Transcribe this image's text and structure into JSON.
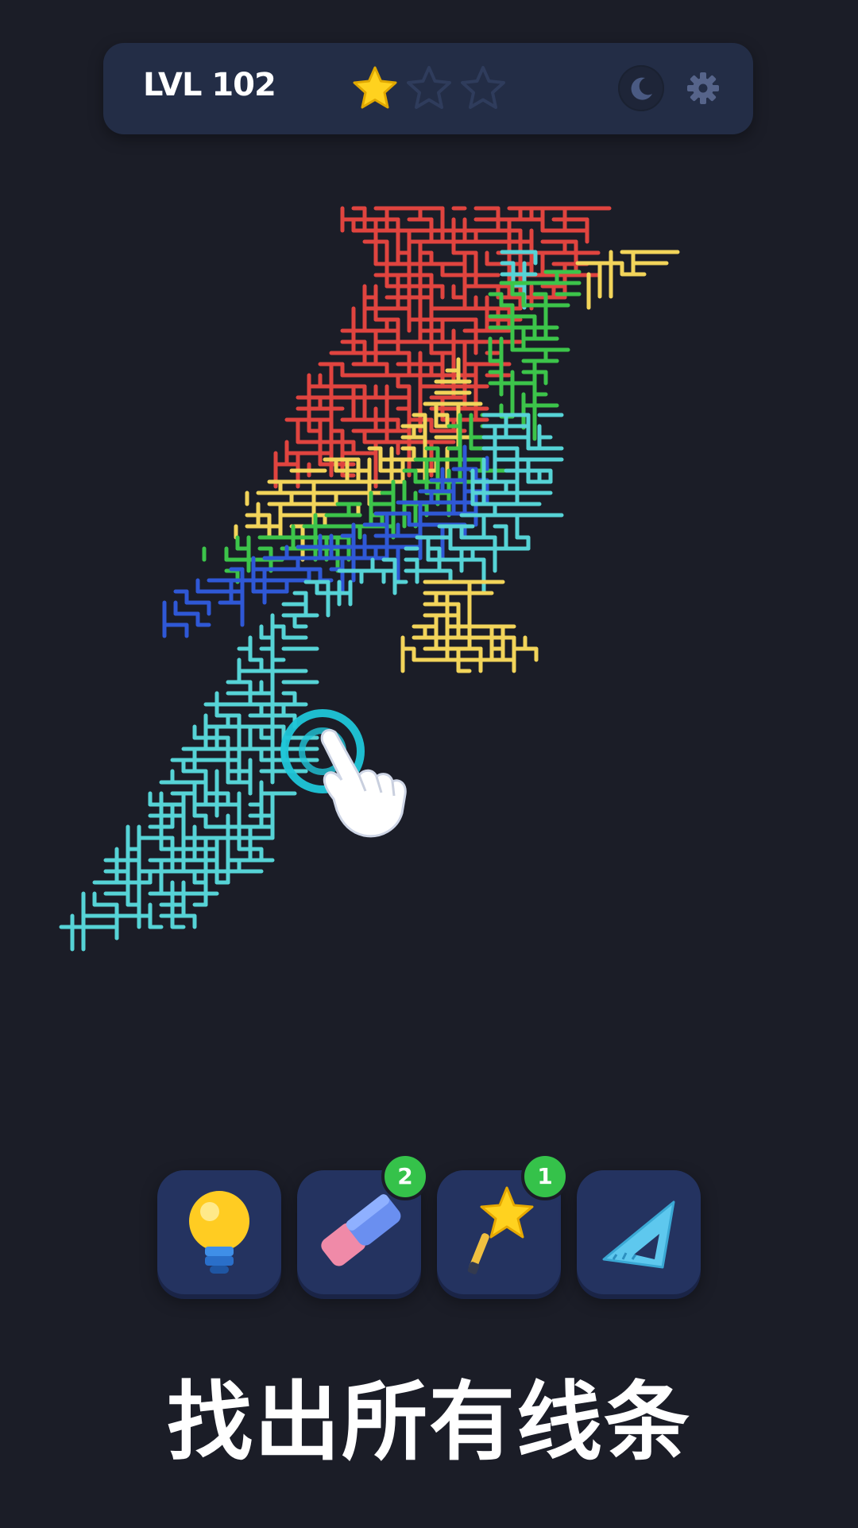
{
  "header": {
    "level_label": "LVL 102",
    "stars_earned": 1,
    "stars_total": 3,
    "moon_icon": "moon-icon",
    "settings_icon": "gear-icon"
  },
  "colors": {
    "background": "#1b1d27",
    "red": "#e0443f",
    "yellow": "#f2d45a",
    "green": "#3cc44a",
    "blue": "#2f58d6",
    "cyan": "#56d3d6",
    "star_gold": "#ffd21f",
    "tap_ring": "#1fc6d8"
  },
  "tools": [
    {
      "name": "hint",
      "icon": "lightbulb-icon",
      "count": null
    },
    {
      "name": "eraser",
      "icon": "eraser-icon",
      "count": "2"
    },
    {
      "name": "magic-wand",
      "icon": "star-wand-icon",
      "count": "1"
    },
    {
      "name": "ruler",
      "icon": "set-square-icon",
      "count": null
    }
  ],
  "tutorial": {
    "hand_icon": "pointing-hand-icon"
  },
  "caption": "找出所有线条"
}
